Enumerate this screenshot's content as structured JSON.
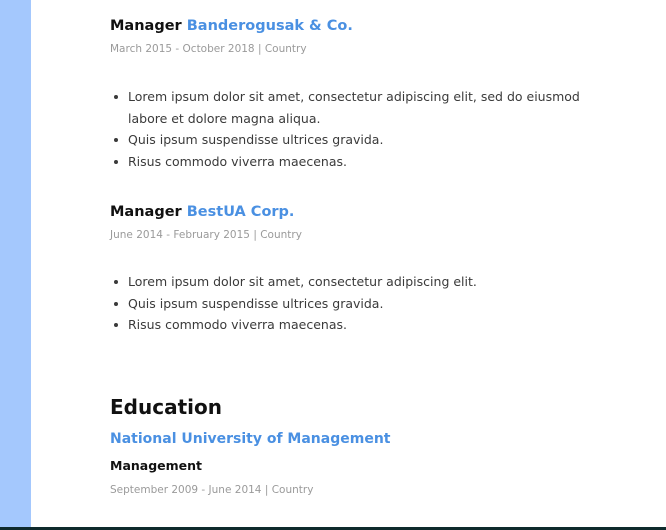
{
  "experience": [
    {
      "role": "Manager",
      "company": "Banderogusak & Co.",
      "meta": "March 2015 - October 2018 | Country",
      "bullets": [
        "Lorem ipsum dolor sit amet, consectetur adipiscing elit, sed do eiusmod labore et dolore magna aliqua.",
        "Quis ipsum suspendisse ultrices gravida.",
        "Risus commodo viverra maecenas."
      ]
    },
    {
      "role": "Manager",
      "company": "BestUA Corp.",
      "meta": "June 2014 - February 2015 | Country",
      "bullets": [
        "Lorem ipsum dolor sit amet, consectetur adipiscing elit.",
        "Quis ipsum suspendisse ultrices gravida.",
        "Risus commodo viverra maecenas."
      ]
    }
  ],
  "education": {
    "heading": "Education",
    "school": "National University of Management",
    "degree": "Management",
    "meta": "September 2009 - June 2014 | Country"
  },
  "colors": {
    "accent": "#4a90e2",
    "stripe": "#a4c8fd",
    "bottom_bar": "#0f2a2c"
  }
}
